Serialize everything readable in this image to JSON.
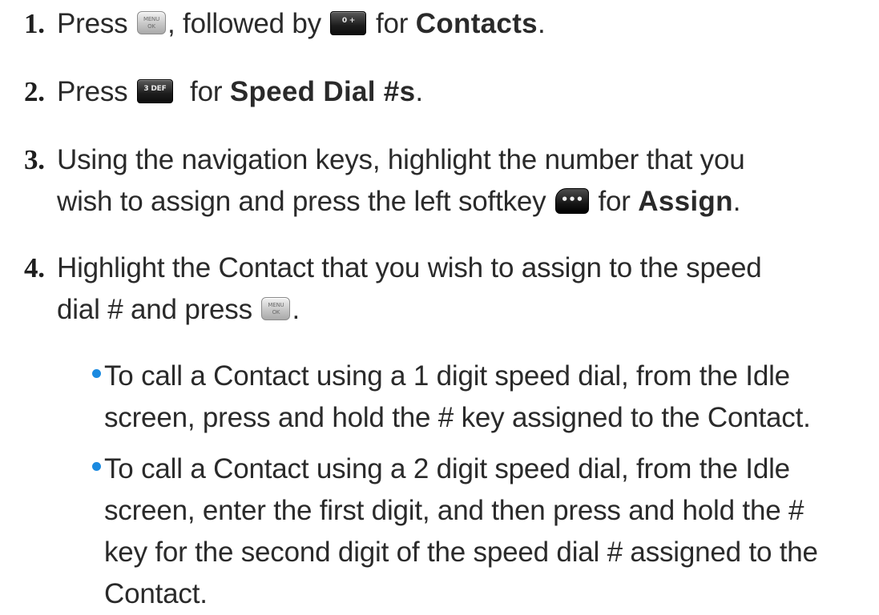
{
  "keys": {
    "menu_line1": "MENU",
    "menu_line2": "OK",
    "key0": "0 +",
    "key3": "3 DEF",
    "softkey": "•••"
  },
  "steps": [
    {
      "number": "1.",
      "parts": [
        "Press ",
        ", followed by ",
        " for ",
        "Contacts",
        "."
      ]
    },
    {
      "number": "2.",
      "parts": [
        "Press ",
        "  for ",
        "Speed Dial #s",
        "."
      ]
    },
    {
      "number": "3.",
      "line1": "Using the navigation keys, highlight the number that you",
      "line2_parts": [
        "wish to assign and press the left softkey ",
        " for ",
        "Assign",
        "."
      ]
    },
    {
      "number": "4.",
      "line1": "Highlight the Contact that you wish to assign to the speed",
      "line2_parts": [
        "dial # and press ",
        "."
      ]
    }
  ],
  "bullets": [
    {
      "lines": [
        "To call a Contact using a 1 digit speed dial, from the Idle",
        "screen, press and hold the # key assigned to the Contact."
      ]
    },
    {
      "lines": [
        "To call a Contact using a 2 digit speed dial, from the Idle",
        "screen, enter the first digit, and then press and hold the #",
        "key for the second digit of the speed dial # assigned to the",
        "Contact."
      ]
    }
  ]
}
